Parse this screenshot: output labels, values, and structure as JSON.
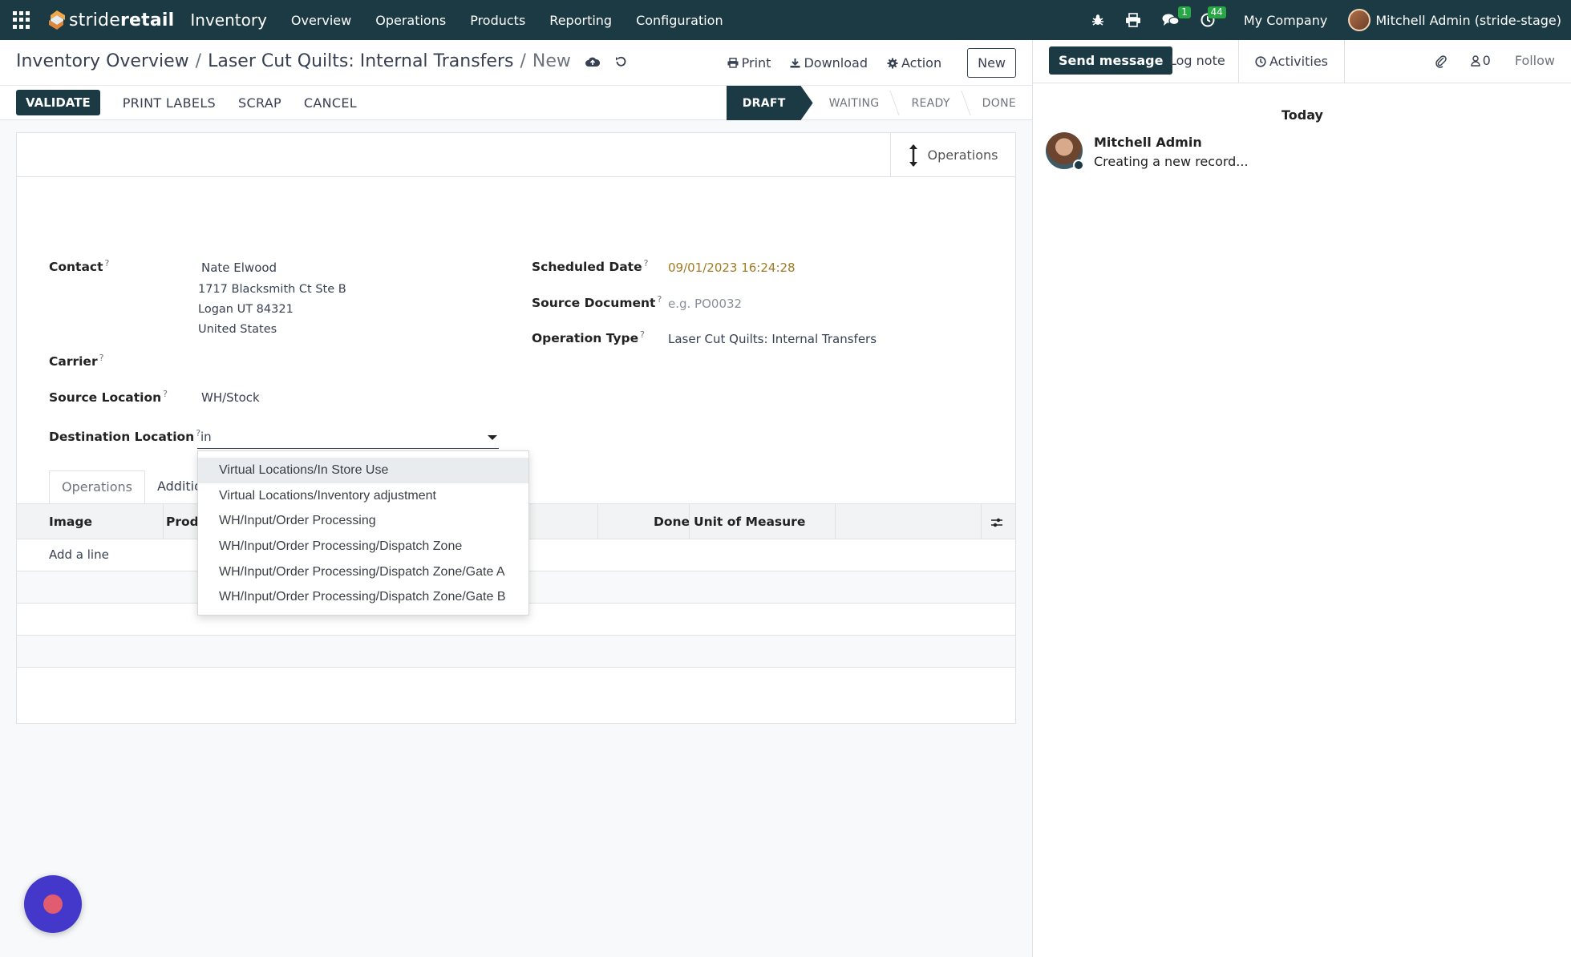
{
  "navbar": {
    "brand_light": "stride",
    "brand_bold": "retail",
    "app_name": "Inventory",
    "menu": [
      "Overview",
      "Operations",
      "Products",
      "Reporting",
      "Configuration"
    ],
    "messages_count": "1",
    "activities_count": "44",
    "company": "My Company",
    "user": "Mitchell Admin (stride-stage)"
  },
  "breadcrumb": {
    "root": "Inventory Overview",
    "parent": "Laser Cut Quilts: Internal Transfers",
    "current": "New"
  },
  "top_actions": {
    "print": "Print",
    "download": "Download",
    "action": "Action",
    "new": "New"
  },
  "statusbar": {
    "buttons": [
      "VALIDATE",
      "PRINT LABELS",
      "SCRAP",
      "CANCEL"
    ],
    "stages": [
      "DRAFT",
      "WAITING",
      "READY",
      "DONE"
    ],
    "active_stage": "DRAFT"
  },
  "smart_button": {
    "label": "Operations"
  },
  "form": {
    "contact_label": "Contact",
    "contact_name": "Nate Elwood",
    "contact_address": [
      "1717 Blacksmith Ct Ste B",
      "Logan UT 84321",
      "United States"
    ],
    "carrier_label": "Carrier",
    "source_location_label": "Source Location",
    "source_location": "WH/Stock",
    "destination_location_label": "Destination Location",
    "destination_location_input": "in",
    "scheduled_date_label": "Scheduled Date",
    "scheduled_date": "09/01/2023 16:24:28",
    "source_document_label": "Source Document",
    "source_document_placeholder": "e.g. PO0032",
    "operation_type_label": "Operation Type",
    "operation_type": "Laser Cut Quilts: Internal Transfers",
    "help_mark": "?"
  },
  "tabs": [
    "Operations",
    "Addition"
  ],
  "table": {
    "headers": [
      "Image",
      "Produ",
      "Done",
      "Unit of Measure"
    ],
    "add_line": "Add a line"
  },
  "dropdown": {
    "options": [
      "Virtual Locations/In Store Use",
      "Virtual Locations/Inventory adjustment",
      "WH/Input/Order Processing",
      "WH/Input/Order Processing/Dispatch Zone",
      "WH/Input/Order Processing/Dispatch Zone/Gate A",
      "WH/Input/Order Processing/Dispatch Zone/Gate B"
    ],
    "highlighted_index": 0
  },
  "chatter": {
    "send_message": "Send message",
    "log_note": "Log note",
    "activities": "Activities",
    "followers_count": "0",
    "follow": "Follow",
    "date_separator": "Today",
    "message_author": "Mitchell Admin",
    "message_body": "Creating a new record..."
  },
  "colors": {
    "navbar_bg": "#1b3a44",
    "primary": "#1b3a44",
    "badge": "#28a745",
    "date_text": "#a07b21",
    "fab": "#4338ca"
  }
}
